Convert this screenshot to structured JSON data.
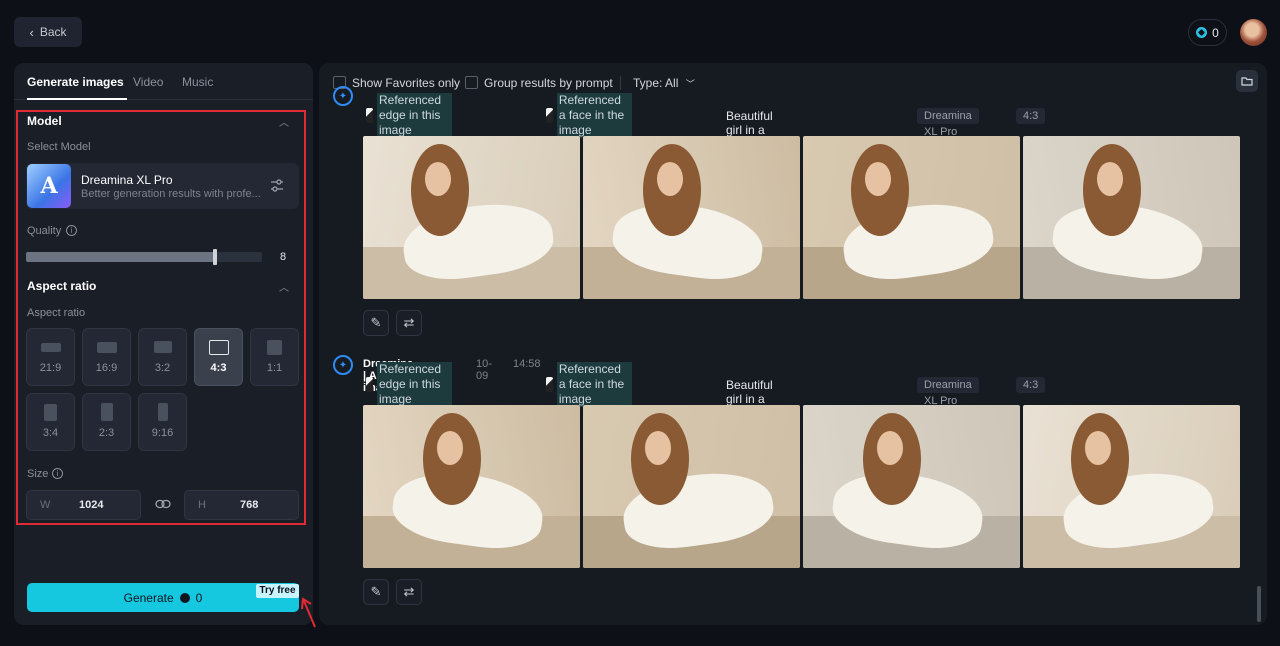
{
  "header": {
    "back_label": "Back",
    "credits": "0"
  },
  "left": {
    "tabs": [
      "Generate images",
      "Video",
      "Music"
    ],
    "model_section": "Model",
    "select_model_label": "Select Model",
    "model_name": "Dreamina XL Pro",
    "model_desc": "Better generation results with profe...",
    "quality_label": "Quality",
    "quality_value": "8",
    "quality_fraction": 0.8,
    "aspect_section": "Aspect ratio",
    "aspect_label": "Aspect ratio",
    "ratios": [
      "21:9",
      "16:9",
      "3:2",
      "4:3",
      "1:1",
      "3:4",
      "2:3",
      "9:16"
    ],
    "selected_ratio": "4:3",
    "size_label": "Size",
    "width_prefix": "W",
    "width": "1024",
    "height_prefix": "H",
    "height": "768",
    "generate_label": "Generate",
    "generate_cost": "0",
    "try_free": "Try free"
  },
  "toolbar": {
    "favorites": "Show Favorites only",
    "group": "Group results by prompt",
    "type": "Type: All"
  },
  "results": [
    {
      "author": "",
      "date": "",
      "time": "",
      "ref1": "Referenced edge in this image",
      "ref2": "Referenced a face in the image",
      "prompt": "Beautiful girl in a delicate white dress",
      "model": "Dreamina XL Pro",
      "ratio": "4:3"
    },
    {
      "author": "Dreamina | AI images",
      "date": "10-09",
      "time": "14:58",
      "ref1": "Referenced edge in this image",
      "ref2": "Referenced a face in the image",
      "prompt": "Beautiful girl in a delicate white dress",
      "model": "Dreamina XL Pro",
      "ratio": "4:3"
    }
  ],
  "colors": {
    "accent": "#16c7e0",
    "highlight_box": "#e02a36"
  }
}
